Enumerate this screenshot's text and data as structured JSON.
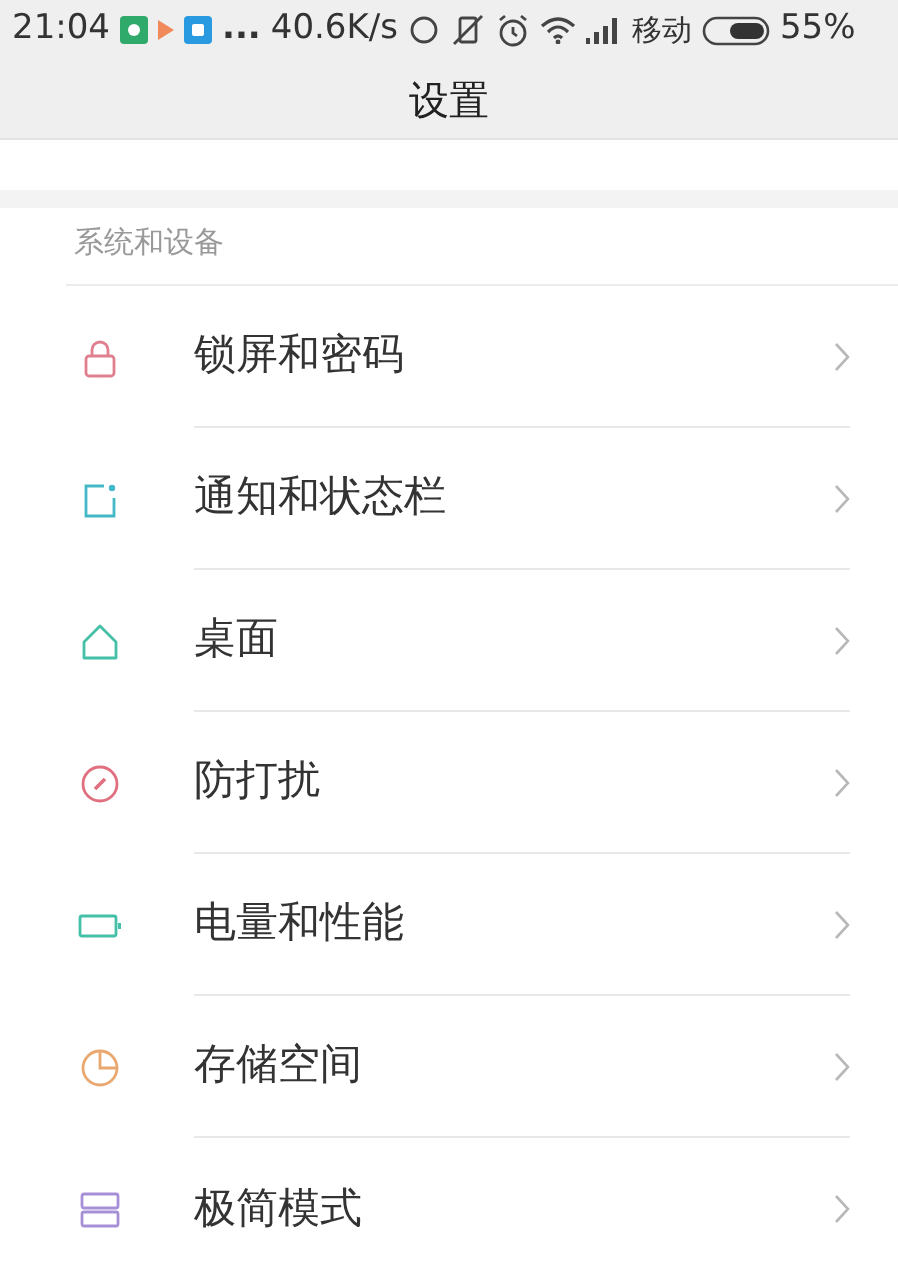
{
  "status_bar": {
    "time": "21:04",
    "more": "...",
    "speed": "40.6K/s",
    "carrier": "移动",
    "battery": "55%"
  },
  "title": "设置",
  "section": {
    "title": "系统和设备",
    "items": [
      {
        "label": "锁屏和密码"
      },
      {
        "label": "通知和状态栏"
      },
      {
        "label": "桌面"
      },
      {
        "label": "防打扰"
      },
      {
        "label": "电量和性能"
      },
      {
        "label": "存储空间"
      },
      {
        "label": "极简模式"
      }
    ]
  }
}
